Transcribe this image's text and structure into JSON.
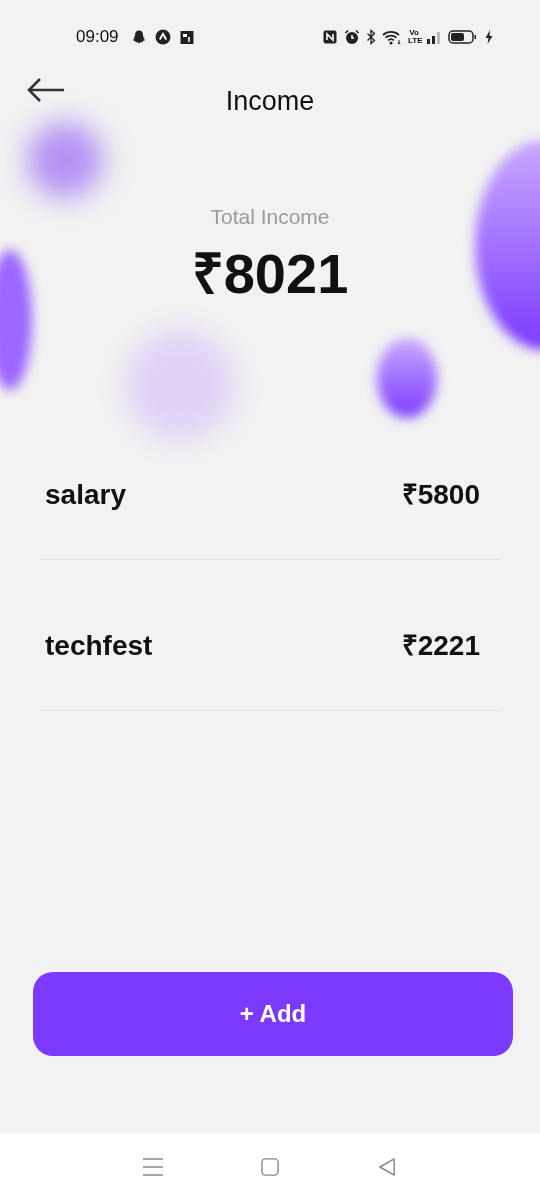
{
  "status_bar": {
    "time": "09:09",
    "network_type": "Vo LTE"
  },
  "header": {
    "title": "Income"
  },
  "summary": {
    "label": "Total Income",
    "amount": "₹8021"
  },
  "entries": [
    {
      "name": "salary",
      "amount": "₹5800"
    },
    {
      "name": "techfest",
      "amount": "₹2221"
    }
  ],
  "add_button": {
    "label": "+ Add"
  }
}
